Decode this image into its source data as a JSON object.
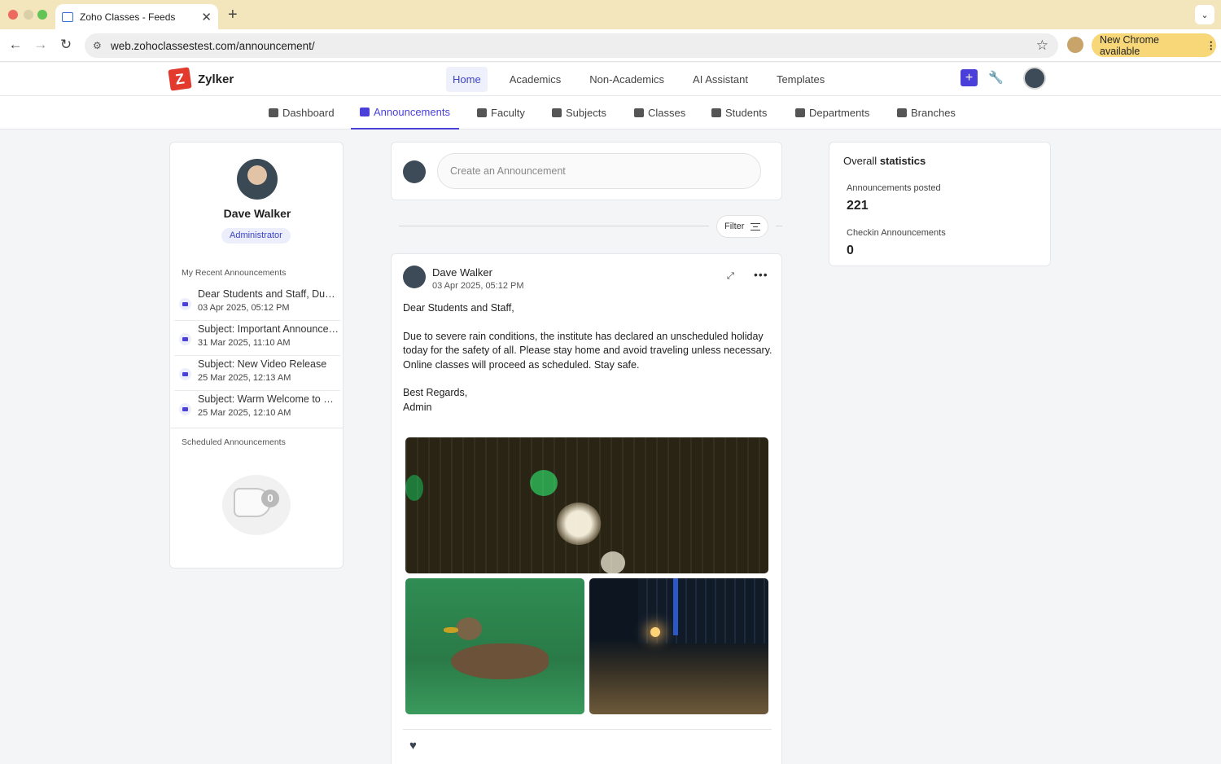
{
  "browser": {
    "tab_title": "Zoho Classes - Feeds",
    "url": "web.zohoclassestest.com/announcement/",
    "update_label": "New Chrome available"
  },
  "app": {
    "brand_letter": "Z",
    "brand": "Zylker",
    "topnav": [
      "Home",
      "Academics",
      "Non-Academics",
      "AI Assistant",
      "Templates"
    ],
    "subnav": [
      "Dashboard",
      "Announcements",
      "Faculty",
      "Subjects",
      "Classes",
      "Students",
      "Departments",
      "Branches"
    ],
    "active_subnav": "Announcements"
  },
  "profile": {
    "name": "Dave Walker",
    "role": "Administrator",
    "recent_label": "My Recent Announcements",
    "recent": [
      {
        "title": "Dear Students and Staff, Due to severe rain conditions",
        "date": "03 Apr 2025, 05:12 PM"
      },
      {
        "title": "Subject: Important Announcement",
        "date": "31 Mar 2025, 11:10 AM"
      },
      {
        "title": "Subject: New Video Release",
        "date": "25 Mar 2025, 12:13 AM"
      },
      {
        "title": "Subject: Warm Welcome to Students",
        "date": "25 Mar 2025, 12:10 AM"
      }
    ],
    "scheduled_label": "Scheduled Announcements",
    "scheduled_count": "0"
  },
  "composer": {
    "placeholder": "Create an Announcement"
  },
  "filter": {
    "label": "Filter"
  },
  "post": {
    "author": "Dave Walker",
    "time": "03 Apr 2025, 05:12 PM",
    "greeting": "Dear Students and Staff,",
    "body": "Due to severe rain conditions, the institute has declared an unscheduled holiday today for the safety of all. Please stay home and avoid traveling unless necessary. Online classes will proceed as scheduled. Stay safe.",
    "signoff1": "Best Regards,",
    "signoff2": "Admin"
  },
  "stats": {
    "title_prefix": "Overall",
    "title_bold": "statistics",
    "posted_label": "Announcements posted",
    "posted_value": "221",
    "checkin_label": "Checkin Announcements",
    "checkin_value": "0"
  },
  "icons": {
    "accent": "#4a40d9",
    "logo_red": "#e23b2e"
  }
}
